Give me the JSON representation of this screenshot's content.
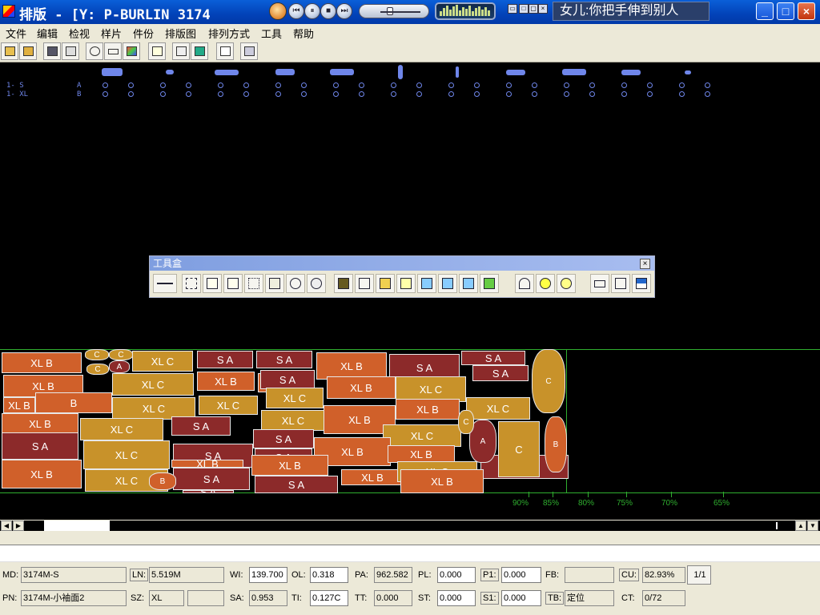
{
  "window": {
    "title": "排版 - [Y:   P-BURLIN   3174",
    "lyrics": "女儿:你把手伸到别人",
    "minimize": "_",
    "maximize": "□",
    "close": "×"
  },
  "menu": [
    "文件",
    "编辑",
    "检视",
    "样片",
    "件份",
    "排版图",
    "排列方式",
    "工具",
    "帮助"
  ],
  "sizes": [
    {
      "label": "1- S",
      "code": "A"
    },
    {
      "label": "1- XL",
      "code": "B"
    }
  ],
  "toolbox": {
    "title": "工具盒",
    "close": "×"
  },
  "pieces": [
    {
      "label": "XL B",
      "color": "#d0602a"
    },
    {
      "label": "C",
      "color": "#c8922a"
    },
    {
      "label": "C",
      "color": "#c8922a"
    },
    {
      "label": "XL C",
      "color": "#c8922a"
    },
    {
      "label": "S A",
      "color": "#8c2a2a"
    },
    {
      "label": "S A",
      "color": "#8c2a2a"
    },
    {
      "label": "XL B",
      "color": "#d0602a"
    },
    {
      "label": "XL C",
      "color": "#c8922a"
    },
    {
      "label": "XL B",
      "color": "#d0602a"
    },
    {
      "label": "XL B",
      "color": "#d0602a"
    },
    {
      "label": "C",
      "color": "#c8922a"
    },
    {
      "label": "A",
      "color": "#8c2a2a"
    },
    {
      "label": "XL C",
      "color": "#c8922a"
    },
    {
      "label": "XL B",
      "color": "#d0602a"
    },
    {
      "label": "S A",
      "color": "#8c2a2a"
    },
    {
      "label": "S A",
      "color": "#8c2a2a"
    },
    {
      "label": "S A",
      "color": "#8c2a2a"
    },
    {
      "label": "S A",
      "color": "#8c2a2a"
    },
    {
      "label": "XL B",
      "color": "#d0602a"
    },
    {
      "label": "B",
      "color": "#d0602a"
    },
    {
      "label": "XL C",
      "color": "#c8922a"
    },
    {
      "label": "XL C",
      "color": "#c8922a"
    },
    {
      "label": "XL B",
      "color": "#d0602a"
    },
    {
      "label": "XL C",
      "color": "#c8922a"
    },
    {
      "label": "XL B",
      "color": "#d0602a"
    },
    {
      "label": "XL C",
      "color": "#c8922a"
    },
    {
      "label": "S A",
      "color": "#8c2a2a"
    },
    {
      "label": "XL C",
      "color": "#c8922a"
    },
    {
      "label": "XL B",
      "color": "#d0602a"
    },
    {
      "label": "S A",
      "color": "#8c2a2a"
    },
    {
      "label": "S A",
      "color": "#8c2a2a"
    },
    {
      "label": "XL B",
      "color": "#d0602a"
    },
    {
      "label": "XL C",
      "color": "#c8922a"
    },
    {
      "label": "XL C",
      "color": "#c8922a"
    },
    {
      "label": "S A",
      "color": "#8c2a2a"
    },
    {
      "label": "XL C",
      "color": "#c8922a"
    },
    {
      "label": "S A",
      "color": "#8c2a2a"
    },
    {
      "label": "XL B",
      "color": "#d0602a"
    },
    {
      "label": "XL B",
      "color": "#d0602a"
    },
    {
      "label": "XL B",
      "color": "#d0602a"
    },
    {
      "label": "XL C",
      "color": "#c8922a"
    },
    {
      "label": "S A",
      "color": "#8c2a2a"
    },
    {
      "label": "XL B",
      "color": "#d0602a"
    },
    {
      "label": "S A",
      "color": "#8c2a2a"
    },
    {
      "label": "XL B",
      "color": "#d0602a"
    },
    {
      "label": "XL C",
      "color": "#c8922a"
    },
    {
      "label": "B",
      "color": "#d0602a"
    },
    {
      "label": "A",
      "color": "#8c2a2a"
    },
    {
      "label": "A",
      "color": "#8c2a2a"
    },
    {
      "label": "C",
      "color": "#c8922a"
    },
    {
      "label": "B",
      "color": "#d0602a"
    },
    {
      "label": "XL B",
      "color": "#d0602a"
    },
    {
      "label": "S A",
      "color": "#8c2a2a"
    },
    {
      "label": "XL B",
      "color": "#d0602a"
    },
    {
      "label": "C",
      "color": "#c8922a"
    },
    {
      "label": "C",
      "color": "#c8922a"
    }
  ],
  "efficiency_marks": [
    "90%",
    "85%",
    "80%",
    "75%",
    "70%",
    "65%"
  ],
  "status": {
    "md_label": "MD:",
    "md_value": "3174M-S",
    "pn_label": "PN:",
    "pn_value": "3174M-小袖面2",
    "ln_label": "LN:",
    "ln_value": "5.519M",
    "sz_label": "SZ:",
    "sz_value": "XL",
    "wi_label": "WI:",
    "wi_value": "139.700",
    "sa_label": "SA:",
    "sa_value": "0.953",
    "ol_label": "OL:",
    "ol_value": "0.318",
    "ti_label": "TI:",
    "ti_value": "0.127C",
    "pa_label": "PA:",
    "pa_value": "962.582",
    "tt_label": "TT:",
    "tt_value": "0.000",
    "pl_label": "PL:",
    "pl_value": "0.000",
    "st_label": "ST:",
    "st_value": "0.000",
    "p1_label": "P1:",
    "p1_value": "0.000",
    "s1_label": "S1:",
    "s1_value": "0.000",
    "fb_label": "FB:",
    "fb_value": "",
    "tb_label": "TB:",
    "tb_value": "定位",
    "cu_label": "CU:",
    "cu_value": "82.93%",
    "ct_label": "CT:",
    "ct_value": "0/72",
    "page": "1/1"
  }
}
